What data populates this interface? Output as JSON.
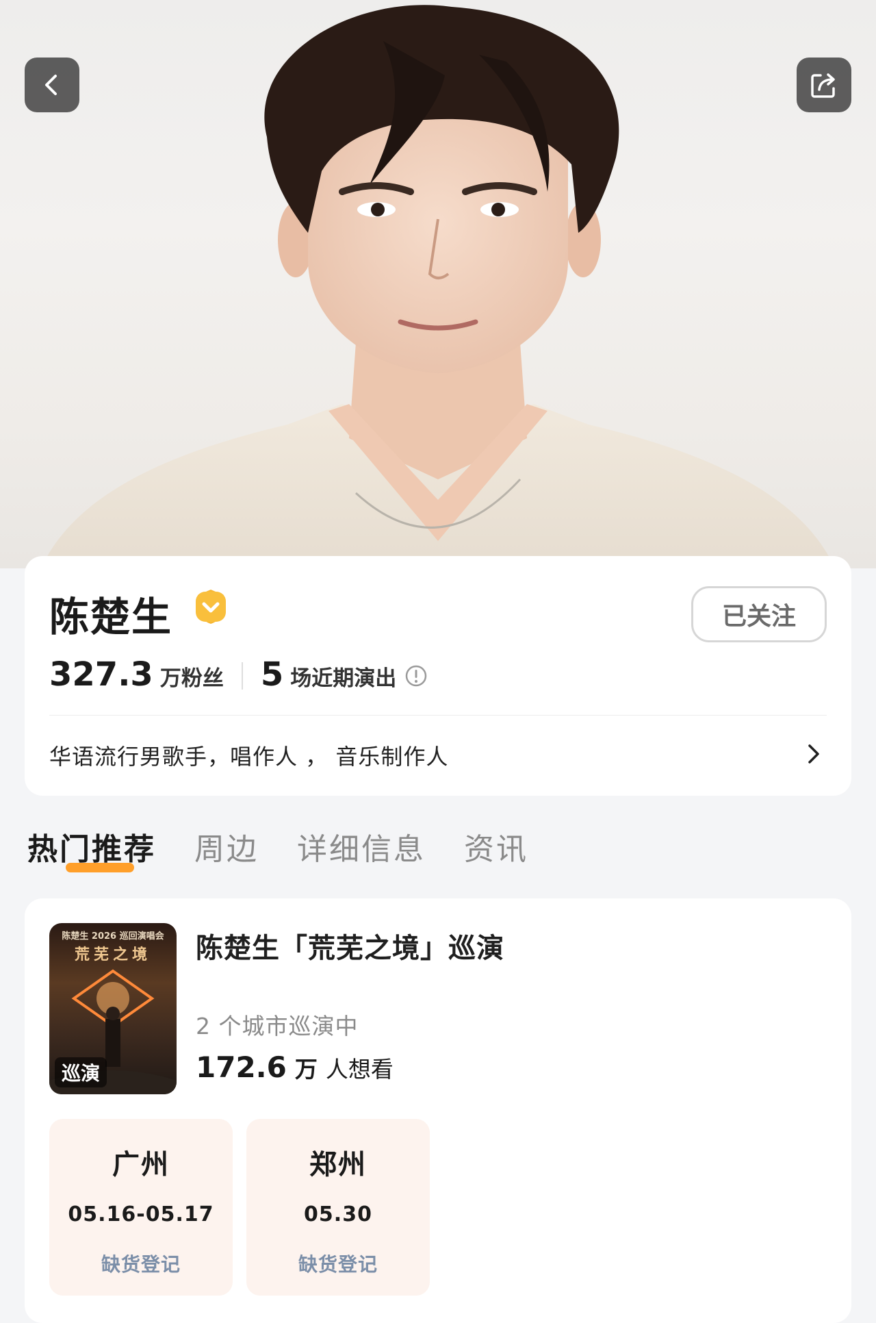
{
  "header": {
    "back_icon": "chevron-left-icon",
    "share_icon": "share-icon"
  },
  "profile": {
    "name": "陈楚生",
    "verified_icon": "verified-badge-icon",
    "follow_label": "已关注",
    "fans_count": "327.3",
    "fans_unit": "万粉丝",
    "shows_count": "5",
    "shows_unit": "场近期演出",
    "bio": "华语流行男歌手，唱作人 ， 音乐制作人"
  },
  "tabs": [
    {
      "label": "热门推荐",
      "active": true
    },
    {
      "label": "周边",
      "active": false
    },
    {
      "label": "详细信息",
      "active": false
    },
    {
      "label": "资讯",
      "active": false
    }
  ],
  "tour": {
    "poster_header": "陈楚生 2026 巡回演唱会",
    "poster_title": "荒芜之境",
    "poster_tag": "巡演",
    "title": "陈楚生「荒芜之境」巡演",
    "cities_text": "2 个城市巡演中",
    "wants_num": "172.6",
    "wants_unit": "万",
    "wants_label": "人想看",
    "cities": [
      {
        "name": "广州",
        "date": "05.16-05.17",
        "status": "缺货登记"
      },
      {
        "name": "郑州",
        "date": "05.30",
        "status": "缺货登记"
      }
    ]
  },
  "colors": {
    "accent": "#ff9a1f",
    "verified": "#f7b733",
    "status_text": "#7b8ea8",
    "city_card_bg": "#fdf3ee"
  }
}
